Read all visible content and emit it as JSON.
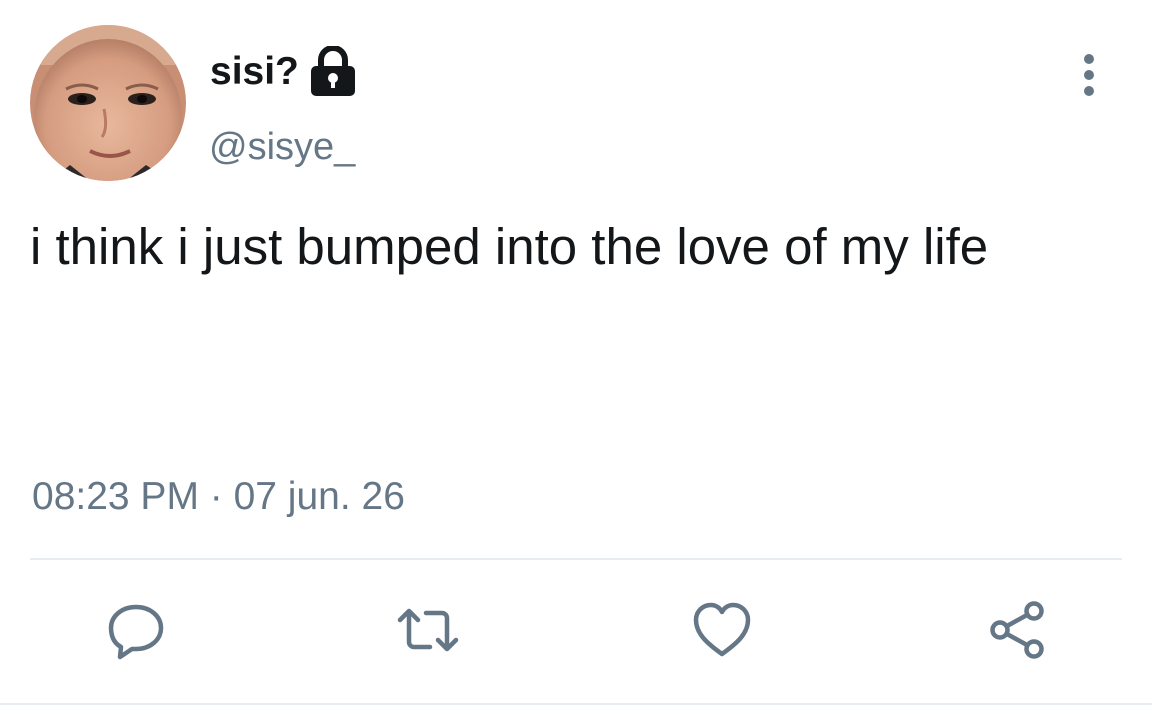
{
  "tweet": {
    "display_name": "sisi?",
    "handle": "@sisye_",
    "text": "i think i just bumped into the love of my life",
    "timestamp": "08:23 PM · 07 jun. 26"
  },
  "icons": {
    "lock": "lock-icon",
    "more": "more-vertical-icon",
    "reply": "reply-icon",
    "retweet": "retweet-icon",
    "like": "heart-icon",
    "share": "share-icon"
  },
  "colors": {
    "text_primary": "#14171a",
    "text_secondary": "#657786",
    "divider": "#e6ecf0"
  }
}
